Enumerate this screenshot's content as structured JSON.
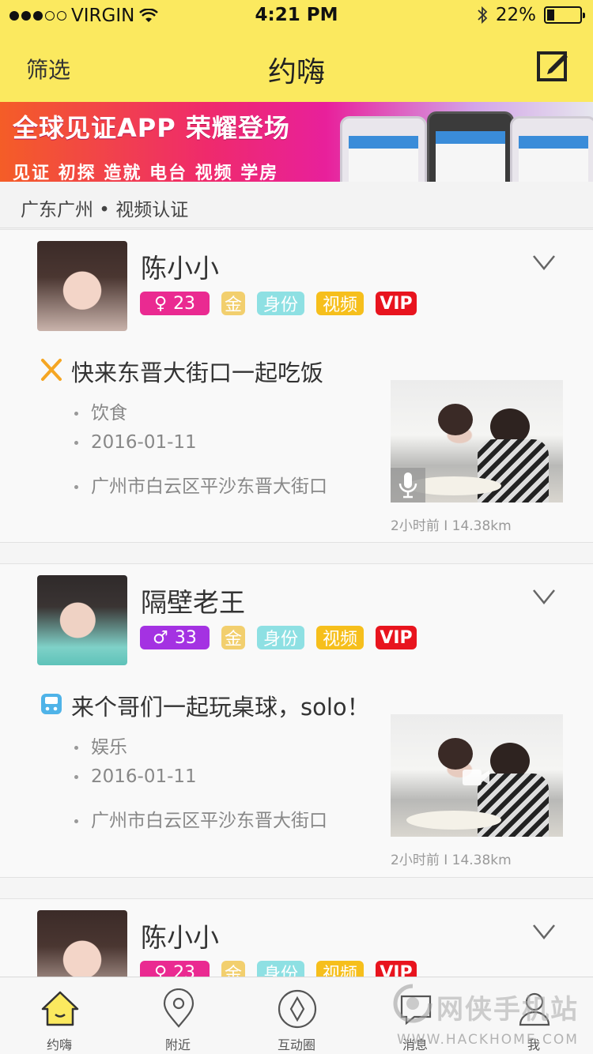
{
  "status_bar": {
    "carrier": "VIRGIN",
    "time": "4:21 PM",
    "battery": "22%"
  },
  "nav": {
    "filter_label": "筛选",
    "title": "约嗨"
  },
  "banner": {
    "headline": "全球见证APP 荣耀登场",
    "subline": "见证 初探 造就 电台 视频 学房"
  },
  "location": {
    "text": "广东广州 • 视频认证"
  },
  "posts": [
    {
      "name": "陈小小",
      "gender_symbol": "♀",
      "age": "23",
      "tags": [
        "金",
        "身份",
        "视频",
        "VIP"
      ],
      "title": "快来东晋大街口一起吃饭",
      "category": "饮食",
      "date": "2016-01-11",
      "address": "广州市白云区平沙东晋大街口",
      "distance": "2小时前 I 14.38km"
    },
    {
      "name": "隔壁老王",
      "gender_symbol": "♂",
      "age": "33",
      "tags": [
        "金",
        "身份",
        "视频",
        "VIP"
      ],
      "title": "来个哥们一起玩桌球，solo！",
      "category": "娱乐",
      "date": "2016-01-11",
      "address": "广州市白云区平沙东晋大街口",
      "distance": "2小时前 I 14.38km"
    },
    {
      "name": "陈小小",
      "gender_symbol": "♀",
      "age": "23",
      "tags": [
        "金",
        "身份",
        "视频",
        "VIP"
      ]
    }
  ],
  "tabbar": {
    "items": [
      "约嗨",
      "附近",
      "互动圈",
      "消息",
      "我"
    ]
  },
  "watermark": {
    "brand": "网侠手机站",
    "url": "WWW.HACKHOME.COM"
  },
  "colors": {
    "accent": "#fbe95f",
    "female": "#ea2a91",
    "male": "#a432e2",
    "vip": "#e8141e"
  }
}
